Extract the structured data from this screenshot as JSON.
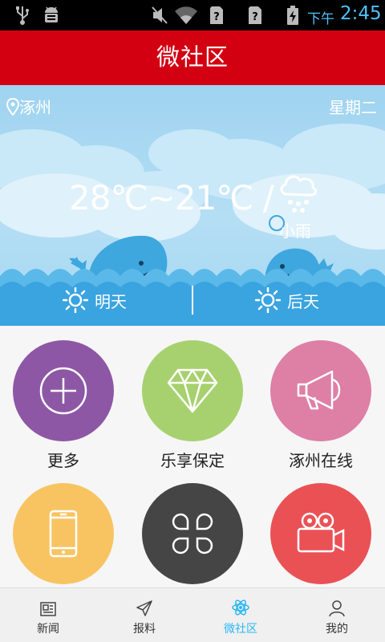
{
  "status_bar": {
    "ampm": "下午",
    "time": "2:45",
    "icons": [
      "usb-icon",
      "android-debug-icon",
      "mute-icon",
      "wifi-icon",
      "sim-unknown-icon",
      "sim-unknown-icon",
      "battery-charging-icon"
    ]
  },
  "header": {
    "title": "微社区"
  },
  "weather": {
    "location": "涿州",
    "weekday": "星期二",
    "temperature": "28℃~21℃ /",
    "condition": "小雨",
    "forecast": [
      {
        "label": "明天",
        "icon": "sun-icon"
      },
      {
        "label": "后天",
        "icon": "sun-icon"
      }
    ]
  },
  "grid": {
    "tiles": [
      {
        "label": "更多",
        "icon": "plus-circle-icon",
        "color": "#8e57a5"
      },
      {
        "label": "乐享保定",
        "icon": "diamond-icon",
        "color": "#a7d16e"
      },
      {
        "label": "涿州在线",
        "icon": "megaphone-icon",
        "color": "#de7fa6"
      },
      {
        "label": "",
        "icon": "phone-icon",
        "color": "#f8c462"
      },
      {
        "label": "",
        "icon": "command-icon",
        "color": "#454545"
      },
      {
        "label": "",
        "icon": "video-camera-icon",
        "color": "#ea5155"
      }
    ]
  },
  "bottom_nav": {
    "items": [
      {
        "label": "新闻",
        "icon": "newspaper-icon",
        "active": false
      },
      {
        "label": "报料",
        "icon": "send-icon",
        "active": false
      },
      {
        "label": "微社区",
        "icon": "atom-icon",
        "active": true
      },
      {
        "label": "我的",
        "icon": "user-icon",
        "active": false
      }
    ],
    "active_color": "#29b6f6"
  }
}
